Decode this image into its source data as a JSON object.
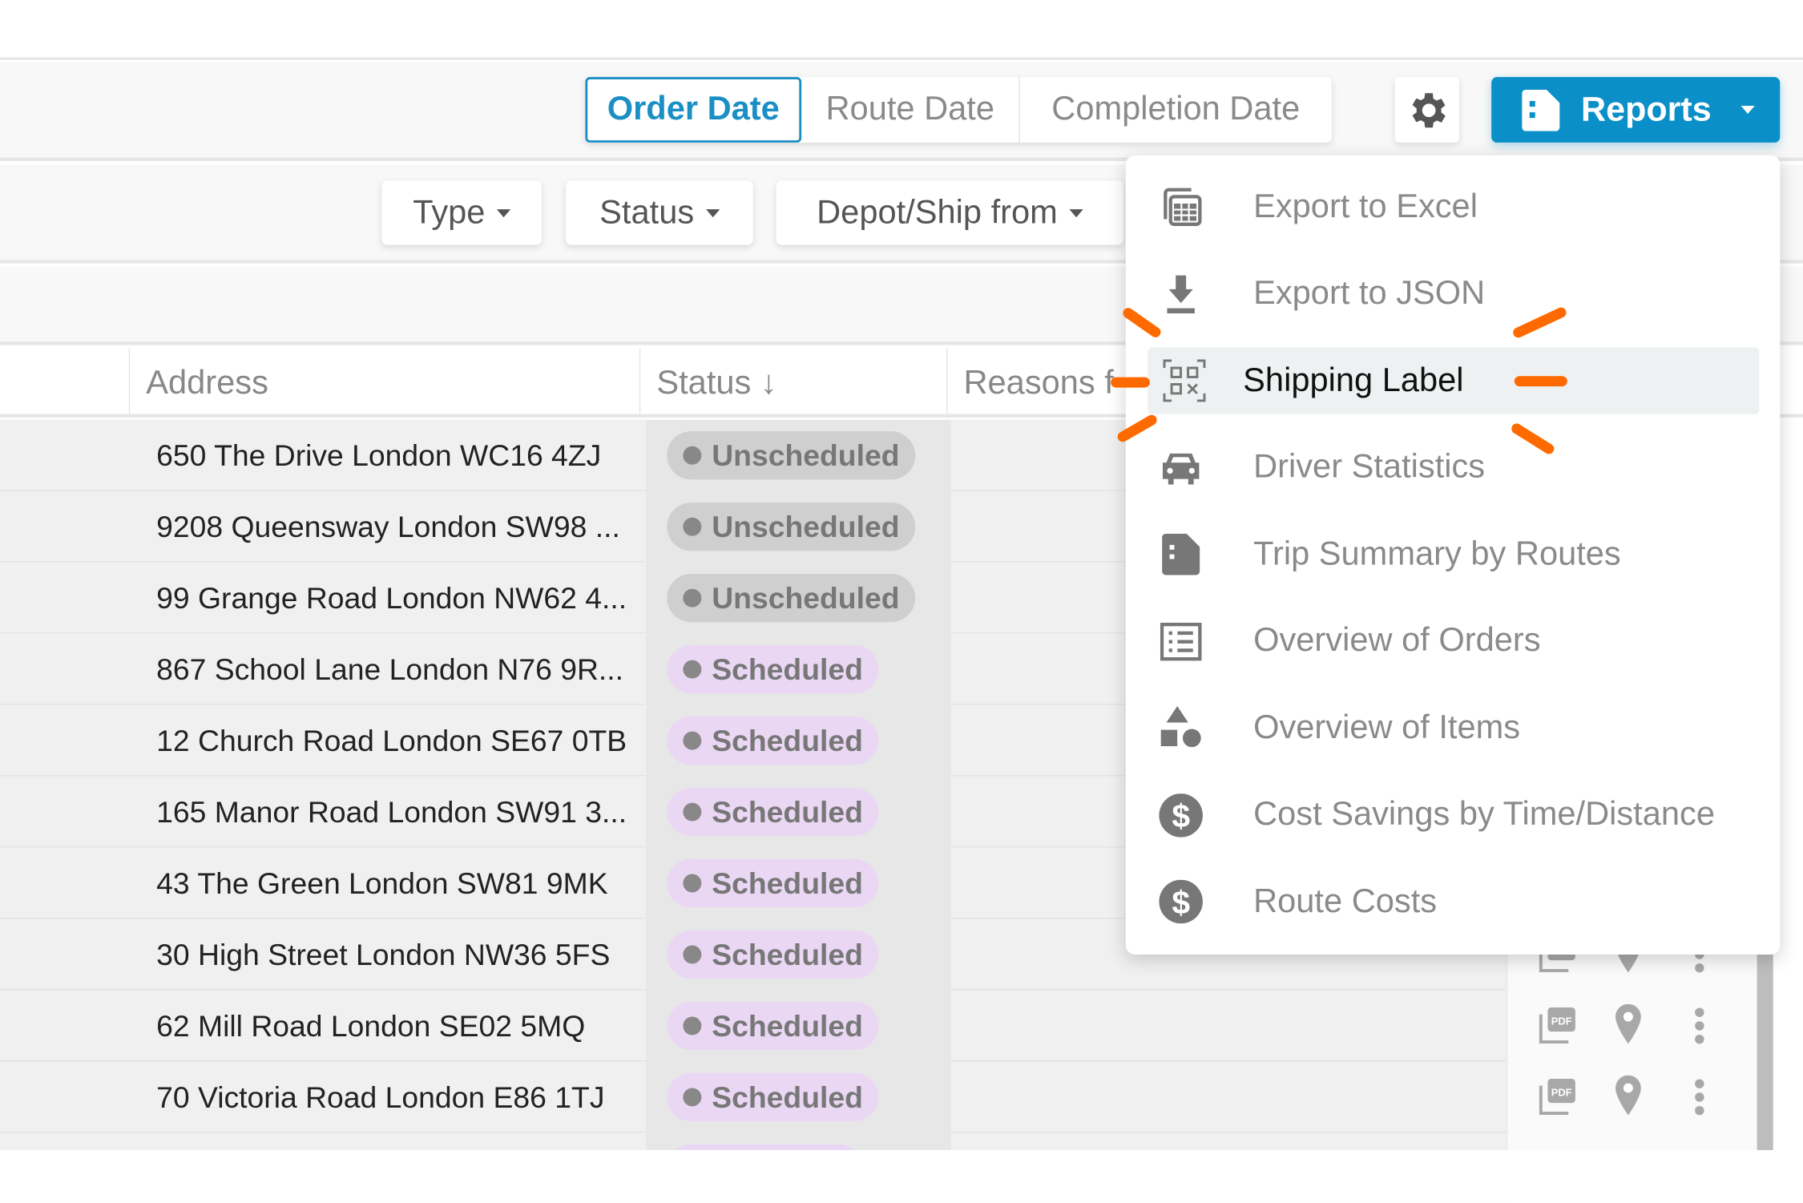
{
  "header": {
    "date_tabs": [
      {
        "label": "Order Date",
        "active": true
      },
      {
        "label": "Route Date",
        "active": false
      },
      {
        "label": "Completion Date",
        "active": false
      }
    ],
    "settings_icon": "gear-icon",
    "reports_label": "Reports",
    "reports_icon": "document-icon"
  },
  "filters": {
    "type_label": "Type",
    "status_label": "Status",
    "depot_label": "Depot/Ship from"
  },
  "table": {
    "columns": {
      "address": "Address",
      "status": "Status ↓",
      "reasons": "Reasons f"
    },
    "rows": [
      {
        "address": "650 The Drive London WC16 4ZJ",
        "status": "Unscheduled"
      },
      {
        "address": "9208 Queensway London SW98 ...",
        "status": "Unscheduled"
      },
      {
        "address": "99 Grange Road London NW62 4...",
        "status": "Unscheduled"
      },
      {
        "address": "867 School Lane London N76 9R...",
        "status": "Scheduled"
      },
      {
        "address": "12 Church Road London SE67 0TB",
        "status": "Scheduled"
      },
      {
        "address": "165 Manor Road London SW91 3...",
        "status": "Scheduled"
      },
      {
        "address": "43 The Green London SW81 9MK",
        "status": "Scheduled"
      },
      {
        "address": "30 High Street London NW36 5FS",
        "status": "Scheduled"
      },
      {
        "address": "62 Mill Road London SE02 5MQ",
        "status": "Scheduled"
      },
      {
        "address": "70 Victoria Road London E86 1TJ",
        "status": "Scheduled"
      }
    ],
    "row_action_icons": [
      "pdf-icon",
      "map-pin-icon",
      "more-vertical-icon"
    ]
  },
  "reports_menu": {
    "items": [
      {
        "label": "Export to Excel",
        "icon": "spreadsheet-icon"
      },
      {
        "label": "Export to JSON",
        "icon": "download-icon"
      },
      {
        "label": "Shipping Label",
        "icon": "qr-code-icon",
        "highlighted": true
      },
      {
        "label": "Driver Statistics",
        "icon": "car-icon"
      },
      {
        "label": "Trip Summary by Routes",
        "icon": "document-icon"
      },
      {
        "label": "Overview of Orders",
        "icon": "list-icon"
      },
      {
        "label": "Overview of Items",
        "icon": "shapes-icon"
      },
      {
        "label": "Cost Savings by Time/Distance",
        "icon": "dollar-icon"
      },
      {
        "label": "Route Costs",
        "icon": "dollar-icon"
      }
    ]
  },
  "colors": {
    "accent": "#0b8fc8",
    "highlight_marks": "#ff6a00",
    "scheduled_pill": "#ead7f4",
    "unscheduled_pill": "#cfcfcf"
  }
}
